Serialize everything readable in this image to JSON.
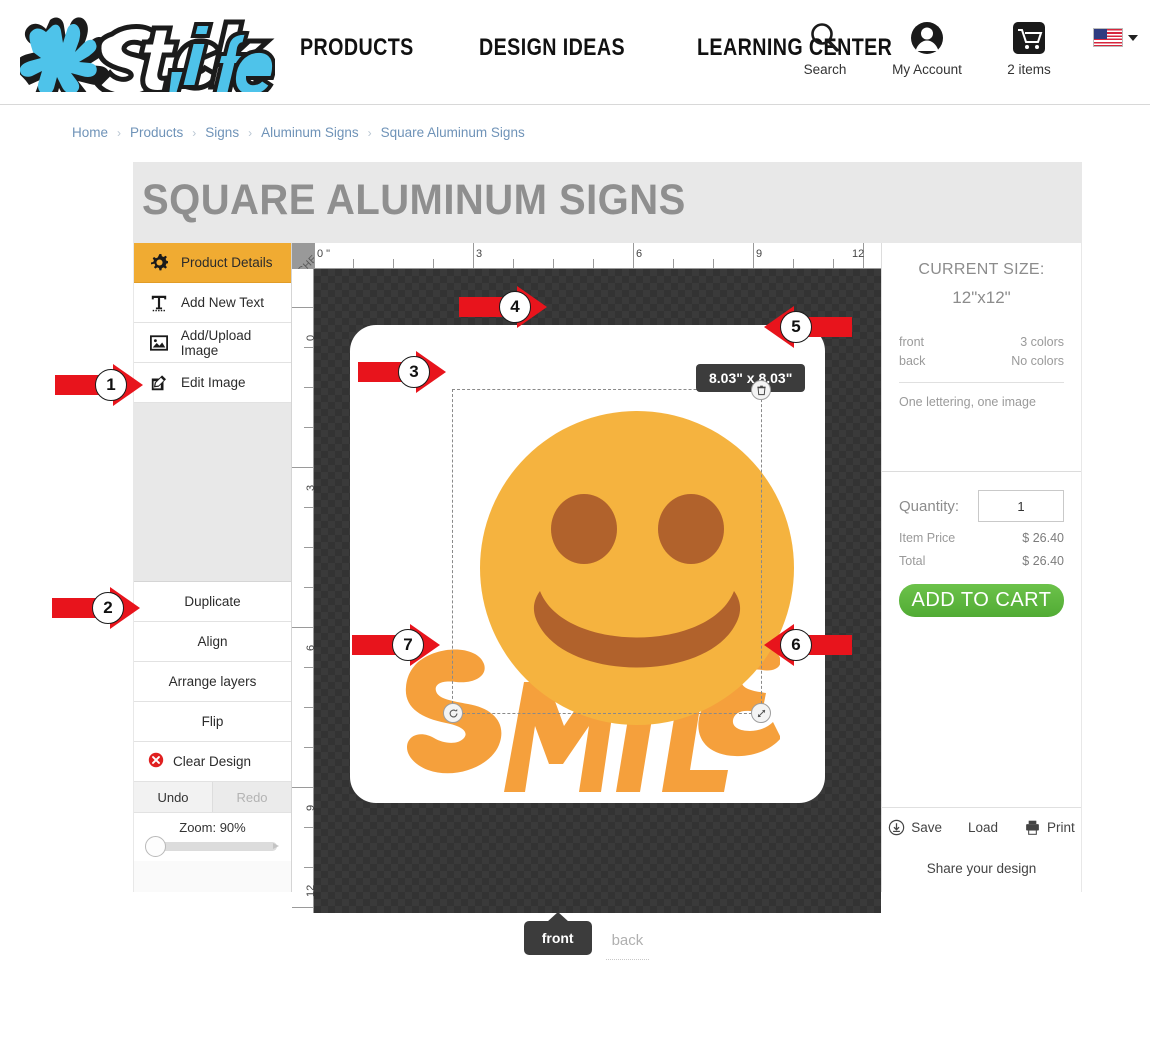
{
  "header": {
    "logo_text": "Stickylife",
    "nav": [
      {
        "label": "PRODUCTS"
      },
      {
        "label": "DESIGN IDEAS"
      },
      {
        "label": "LEARNING CENTER"
      }
    ],
    "utilities": [
      {
        "icon": "search-icon",
        "label": "Search"
      },
      {
        "icon": "user-account-icon",
        "label": "My Account"
      },
      {
        "icon": "shopping-cart-icon",
        "label": "2 items"
      }
    ],
    "locale": {
      "icon": "us-flag-icon",
      "caret": "chevron-down-icon"
    }
  },
  "breadcrumb": {
    "separator": "›",
    "items": [
      "Home",
      "Products",
      "Signs",
      "Aluminum Signs",
      "Square Aluminum Signs"
    ]
  },
  "page": {
    "title": "SQUARE ALUMINUM SIGNS"
  },
  "left_sidebar": {
    "tools": [
      {
        "label": "Product Details",
        "icon": "gear-icon",
        "active": true
      },
      {
        "label": "Add New Text",
        "icon": "text-t-icon",
        "active": false
      },
      {
        "label": "Add/Upload Image",
        "icon": "image-icon",
        "active": false
      },
      {
        "label": "Edit Image",
        "icon": "pencil-edit-icon",
        "active": false
      }
    ],
    "actions": [
      {
        "label": "Duplicate",
        "icon": ""
      },
      {
        "label": "Align",
        "icon": ""
      },
      {
        "label": "Arrange layers",
        "icon": ""
      },
      {
        "label": "Flip",
        "icon": ""
      },
      {
        "label": "Clear Design",
        "icon": "clear-x-icon"
      }
    ],
    "undo_label": "Undo",
    "redo_label": "Redo",
    "zoom_label": "Zoom: 90%",
    "zoom_percent": 90
  },
  "canvas": {
    "ruler_corner_label": "INCHES",
    "ruler_h_ticks": [
      "0 \"",
      "3",
      "6",
      "9",
      "12"
    ],
    "ruler_v_ticks": [
      "0 \"",
      "3",
      "6",
      "9",
      "12"
    ],
    "size_badge": "8.03\" x 8.03\"",
    "artwork_text": "SMILE",
    "handles": {
      "delete": "trash-icon",
      "rotate": "rotate-icon",
      "resize": "resize-diagonal-icon"
    },
    "side_tabs": {
      "front": "front",
      "back": "back"
    }
  },
  "right_panel": {
    "current_size_title": "CURRENT SIZE:",
    "current_size_value": "12\"x12\"",
    "sides": [
      {
        "label": "front",
        "value": "3 colors"
      },
      {
        "label": "back",
        "value": "No colors"
      }
    ],
    "contents_note": "One lettering, one image",
    "quantity_label": "Quantity:",
    "quantity_value": "1",
    "prices": [
      {
        "label": "Item Price",
        "value": "$ 26.40"
      },
      {
        "label": "Total",
        "value": "$ 26.40"
      }
    ],
    "add_to_cart_label": "ADD TO CART",
    "save_label": "Save",
    "load_label": "Load",
    "print_label": "Print",
    "share_label": "Share your design"
  },
  "markers": [
    {
      "number": "1",
      "direction": "right"
    },
    {
      "number": "2",
      "direction": "right"
    },
    {
      "number": "3",
      "direction": "right"
    },
    {
      "number": "4",
      "direction": "right"
    },
    {
      "number": "5",
      "direction": "left"
    },
    {
      "number": "6",
      "direction": "left"
    },
    {
      "number": "7",
      "direction": "right"
    }
  ],
  "colors": {
    "accent_orange": "#f0ab32",
    "cart_green": "#5fb83d",
    "marker_red": "#e8141c",
    "logo_blue": "#4ec3ea",
    "smiley_yellow": "#f5b33f",
    "smiley_brown": "#b1622c",
    "smile_text_orange": "#f5a council"
  }
}
